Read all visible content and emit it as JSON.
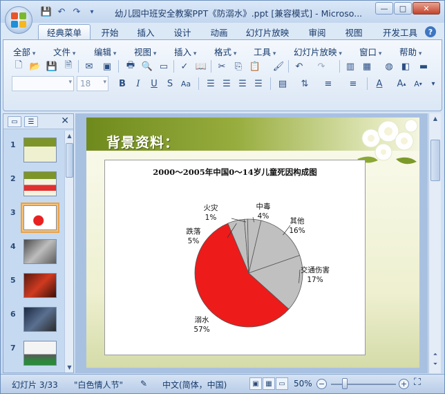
{
  "window": {
    "title": "幼儿园中班安全教案PPT《防溺水》.ppt [兼容模式] - Microso...",
    "buttons": {
      "minimize": "—",
      "maximize": "□",
      "close": "✕"
    }
  },
  "ribbon": {
    "tabs": [
      "经典菜单",
      "开始",
      "插入",
      "设计",
      "动画",
      "幻灯片放映",
      "审阅",
      "视图",
      "开发工具"
    ],
    "active_tab": "经典菜单",
    "menus": [
      "全部",
      "文件",
      "编辑",
      "视图",
      "插入",
      "格式",
      "工具",
      "幻灯片放映",
      "窗口",
      "帮助"
    ],
    "font_size_value": "18",
    "help_icon": "?"
  },
  "slide_pane": {
    "thumbs": [
      {
        "num": "1",
        "style": "green-title"
      },
      {
        "num": "2",
        "style": "red-bars"
      },
      {
        "num": "3",
        "style": "pie-chart"
      },
      {
        "num": "4",
        "style": "photo-gray"
      },
      {
        "num": "5",
        "style": "photo-red"
      },
      {
        "num": "6",
        "style": "photo-blue"
      },
      {
        "num": "7",
        "style": "photo-white"
      }
    ],
    "active_index": 2
  },
  "slide": {
    "title": "背景资料：",
    "chart_title": "2000～2005年中国0～14岁儿童死因构成图"
  },
  "chart_data": {
    "type": "pie",
    "title": "2000～2005年中国0～14岁儿童死因构成图",
    "slices": [
      {
        "label": "溺水",
        "percent_label": "57%",
        "value": 57,
        "color": "#ee1b1b"
      },
      {
        "label": "跌落",
        "percent_label": "5%",
        "value": 5,
        "color": "#c0c0c0"
      },
      {
        "label": "火灾",
        "percent_label": "1%",
        "value": 1,
        "color": "#c0c0c0"
      },
      {
        "label": "中毒",
        "percent_label": "4%",
        "value": 4,
        "color": "#c0c0c0"
      },
      {
        "label": "其他",
        "percent_label": "16%",
        "value": 16,
        "color": "#c0c0c0"
      },
      {
        "label": "交通伤害",
        "percent_label": "17%",
        "value": 17,
        "color": "#c0c0c0"
      }
    ]
  },
  "statusbar": {
    "slide_info": "幻灯片 3/33",
    "theme": "\"白色情人节\"",
    "language": "中文(简体，中国)",
    "zoom": "50%"
  }
}
